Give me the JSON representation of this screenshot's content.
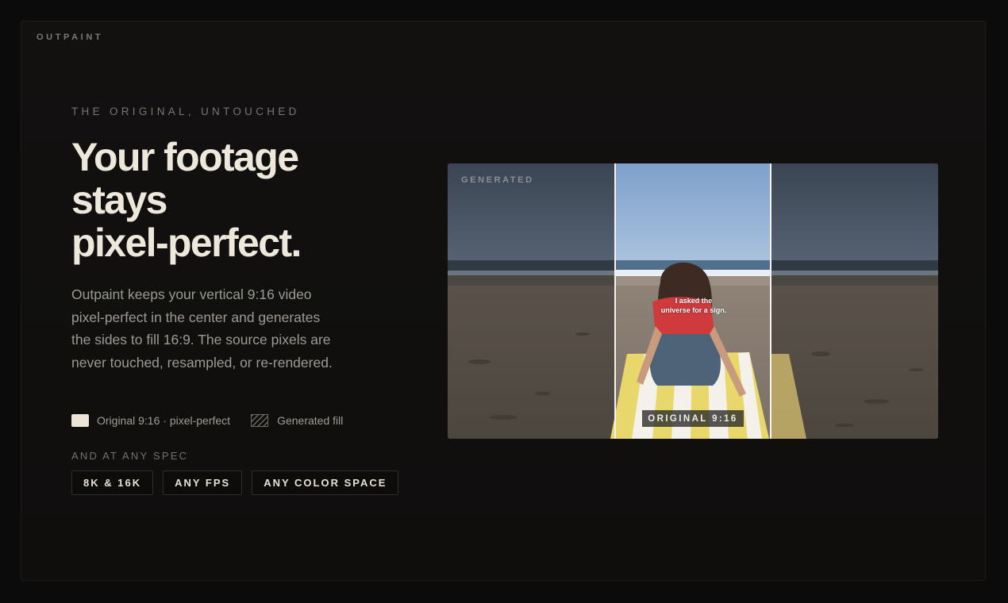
{
  "brand": "OUTPAINT",
  "hero": {
    "eyebrow": "THE ORIGINAL, UNTOUCHED",
    "headline": [
      "Your footage",
      "stays",
      "pixel-perfect."
    ],
    "description": "Outpaint keeps your vertical 9:16 video pixel-perfect in the center and generates the sides to fill 16:9. The source pixels are never touched, resampled, or re-rendered."
  },
  "legend": {
    "original": "Original 9:16 · pixel-perfect",
    "generated": "Generated fill"
  },
  "spec": {
    "label": "AND AT ANY SPEC",
    "chips": [
      "8K & 16K",
      "ANY FPS",
      "ANY COLOR SPACE"
    ]
  },
  "preview": {
    "generated_tag": "GENERATED",
    "subtitle": [
      "I asked the",
      "universe for a sign."
    ],
    "original_tag": "ORIGINAL 9:16"
  },
  "colors": {
    "background": "#0c0b0b",
    "headline": "#ede7dc",
    "body_text": "#9e9a93",
    "original_swatch": "#ece5d8"
  }
}
